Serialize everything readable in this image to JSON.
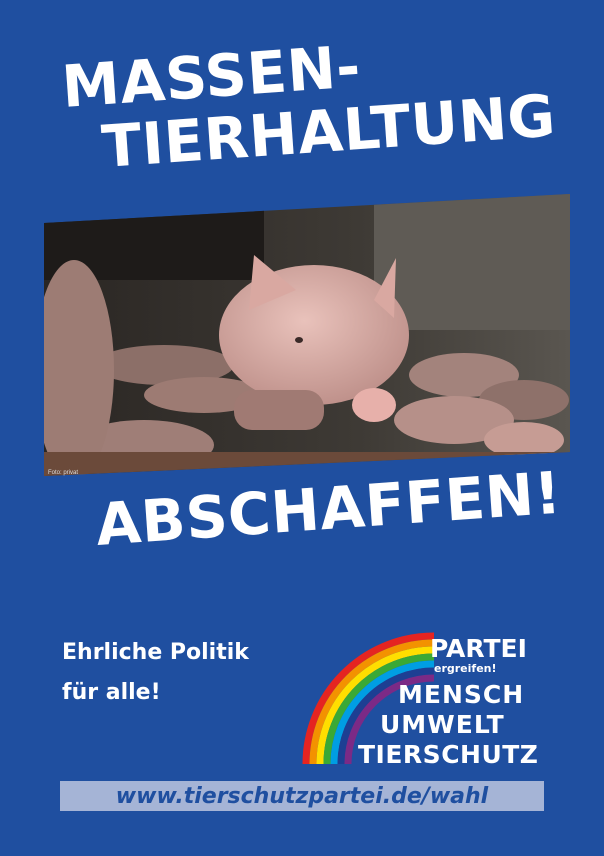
{
  "headline": {
    "line1": "MASSEN-",
    "line2": "TIERHALTUNG",
    "line3": "ABSCHAFFEN!"
  },
  "photo": {
    "credit": "Foto: privat"
  },
  "slogan": {
    "line1": "Ehrliche Politik",
    "line2": "für alle!"
  },
  "logo": {
    "partei": "PARTEI",
    "ergreifen": "ergreifen!",
    "mensch": "MENSCH",
    "umwelt": "UMWELT",
    "tierschutz": "TIERSCHUTZ",
    "rainbow_colors": [
      "#e52421",
      "#f39200",
      "#ffde00",
      "#3aa935",
      "#009ee3",
      "#1d3f93",
      "#7b2a86"
    ]
  },
  "url": "www.tierschutzpartei.de/wahl",
  "colors": {
    "background": "#1f4fa0",
    "text": "#ffffff",
    "url_bar": "#a5b4d6"
  }
}
